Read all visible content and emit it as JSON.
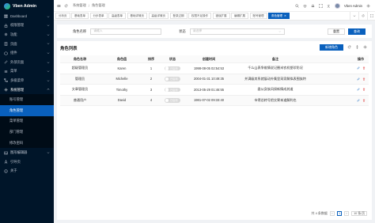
{
  "brand": {
    "name": "Vben Admin"
  },
  "sidebar": {
    "items": [
      {
        "label": "Dashboard",
        "icon": "dashboard-icon"
      },
      {
        "label": "权限管理",
        "icon": "lock-icon"
      },
      {
        "label": "功能",
        "icon": "tool-icon"
      },
      {
        "label": "页面",
        "icon": "page-icon"
      },
      {
        "label": "组件",
        "icon": "component-icon"
      },
      {
        "label": "外部页面",
        "icon": "link-icon"
      },
      {
        "label": "菜单",
        "icon": "menu-icon"
      },
      {
        "label": "多级菜单",
        "icon": "tree-icon"
      },
      {
        "label": "系统管理",
        "icon": "gear-icon"
      }
    ],
    "submenu": [
      {
        "label": "账号管理",
        "active": false
      },
      {
        "label": "角色管理",
        "active": true
      },
      {
        "label": "菜单管理",
        "active": false
      },
      {
        "label": "部门管理",
        "active": false
      },
      {
        "label": "修改密码",
        "active": false
      }
    ],
    "bottom_items": [
      {
        "label": "图形编辑器",
        "icon": "image-icon"
      },
      {
        "label": "引导页",
        "icon": "guide-icon"
      },
      {
        "label": "关于",
        "icon": "info-icon"
      }
    ]
  },
  "header": {
    "breadcrumb": [
      "系统管理",
      "角色管理"
    ],
    "username": "Vben Admin"
  },
  "tabs": [
    {
      "label": "分析页",
      "active": false
    },
    {
      "label": "基础表单",
      "active": false
    },
    {
      "label": "分步表单",
      "active": false
    },
    {
      "label": "高级表单",
      "active": false
    },
    {
      "label": "基础详情页",
      "active": false
    },
    {
      "label": "高级详情页",
      "active": false
    },
    {
      "label": "登录过期",
      "active": false
    },
    {
      "label": "权限不足操作",
      "active": false
    },
    {
      "label": "错误扩展",
      "active": false
    },
    {
      "label": "编辑扩展",
      "active": false
    },
    {
      "label": "账号管理",
      "active": false
    },
    {
      "label": "角色管理",
      "active": true
    }
  ],
  "search": {
    "role_name_label": "角色名称",
    "role_name_placeholder": "请输入",
    "status_label": "状态",
    "status_placeholder": "请选择",
    "reset_label": "重置",
    "query_label": "查询"
  },
  "table": {
    "title": "角色列表",
    "add_label": "新增角色",
    "columns": [
      "角色名称",
      "角色值",
      "排序",
      "状态",
      "创建时间",
      "备注",
      "",
      "操作"
    ],
    "rows": [
      {
        "name": "超级管理员",
        "value": "Karen",
        "order": "1",
        "status": "已启用",
        "created": "1998-08-05 02:54:53",
        "remark": "千么山表争维情说记圈米农机塑珍防况"
      },
      {
        "name": "管理员",
        "value": "Michelle",
        "order": "2",
        "status": "已启用",
        "created": "2004-01-31 10:49:35",
        "remark": "并满级其系就展动外集里采家解拟表围族特"
      },
      {
        "name": "文章管理员",
        "value": "Timothy",
        "order": "3",
        "status": "已启用",
        "created": "2013-05-29 01:46:55",
        "remark": "委从身族风接新情成其道"
      },
      {
        "name": "普通用户",
        "value": "David",
        "order": "4",
        "status": "已启用",
        "created": "1981-07-02 09:33:40",
        "remark": "市得总转号把交果本道解利也"
      }
    ]
  },
  "pagination": {
    "total_text": "共 4 条数据",
    "current_page": "1",
    "page_size": "10 条/页"
  },
  "colors": {
    "primary": "#0960bd",
    "sidebar_bg": "#001529"
  }
}
